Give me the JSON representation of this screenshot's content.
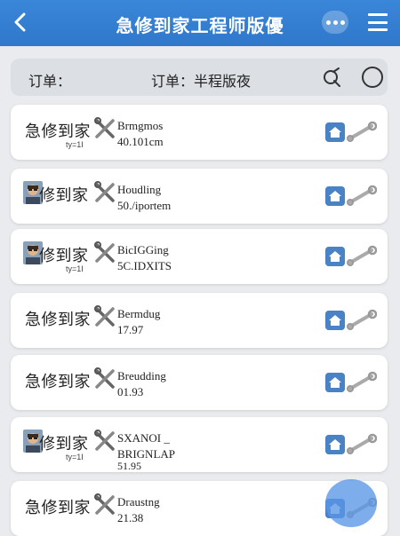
{
  "header": {
    "title": "急修到家工程师版優",
    "back_icon": "chevron-left-icon",
    "more_icon": "more-horizontal-icon",
    "menu_icon": "hamburger-menu-icon",
    "color": "#3a86d8"
  },
  "filter": {
    "label_left": "订单：",
    "label_right": "订单：半程版夜",
    "filter_icon": "filter-search-icon",
    "circle_icon": "circle-icon"
  },
  "orders": [
    {
      "name": "急修到家",
      "avatar": false,
      "sub": "ty=1I",
      "line1": "Brmgmos",
      "line2": "40.101cm",
      "line3": ""
    },
    {
      "name": "修到家",
      "avatar": true,
      "sub": "",
      "line1": "Houdling",
      "line2": "50./iportem",
      "line3": ""
    },
    {
      "name": "修到家",
      "avatar": true,
      "sub": "ty=1I",
      "line1": "BicIGGing",
      "line2": "5C.IDXITS",
      "line3": ""
    },
    {
      "name": "急修到家",
      "avatar": false,
      "sub": "",
      "line1": "Bermdug",
      "line2": "17.97",
      "line3": ""
    },
    {
      "name": "急修到家",
      "avatar": false,
      "sub": "",
      "line1": "Breudding",
      "line2": "01.93",
      "line3": ""
    },
    {
      "name": "修到家",
      "avatar": true,
      "sub": "ty=1I",
      "line1": "SXANOI _",
      "line2": "BRIGNLAP",
      "line3": "51.95"
    },
    {
      "name": "急修到家",
      "avatar": false,
      "sub": "",
      "line1": "Draustng",
      "line2": "21.38",
      "line3": ""
    }
  ],
  "icons": {
    "tool": "tools-icon",
    "home": "home-icon",
    "wrench": "wrench-icon",
    "fab": "floating-action-button"
  }
}
